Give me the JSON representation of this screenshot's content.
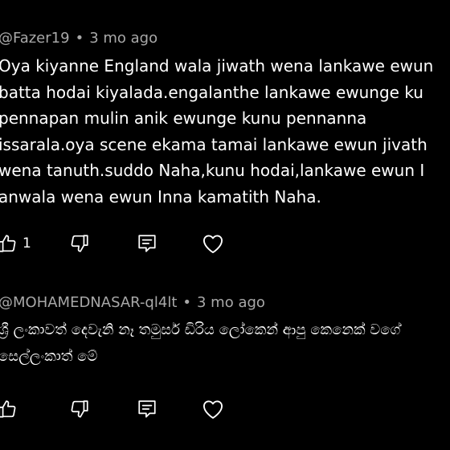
{
  "comments": [
    {
      "author": "@Fazer19",
      "separator": "•",
      "time": "3 mo ago",
      "lines": [
        "Oya kiyanne England wala jiwath wena lankawe ewun",
        "batta hodai kiyalada.engalanthe lankawe ewunge  ku",
        "pennapan mulin anik ewunge kunu pennanna",
        "issarala.oya scene ekama  tamai lankawe ewun jivath",
        "wena tanuth.suddo Naha,kunu hodai,lankawe ewun I",
        "anwala wena ewun Inna kamatith Naha."
      ],
      "like_count": "1",
      "icons": [
        "thumbs-up-icon",
        "thumbs-down-icon",
        "reply-icon",
        "heart-icon"
      ]
    },
    {
      "author": "@MOHAMEDNASAR-ql4lt",
      "separator": "•",
      "time": "3 mo ago",
      "lines": [
        "ශ්‍රී ලංකාවත් දෙවැනි නෑ තමුසර් ඩිරිය ලෝකෙන් ආපු කෙනෙක් වගේ",
        "සෙල්ලංකාත් මේ"
      ],
      "like_count": "",
      "icons": [
        "thumbs-up-icon",
        "thumbs-down-icon",
        "reply-icon",
        "heart-icon"
      ]
    }
  ],
  "colors": {
    "background": "#000000",
    "text": "#ffffff",
    "meta": "#a8a8a8"
  }
}
